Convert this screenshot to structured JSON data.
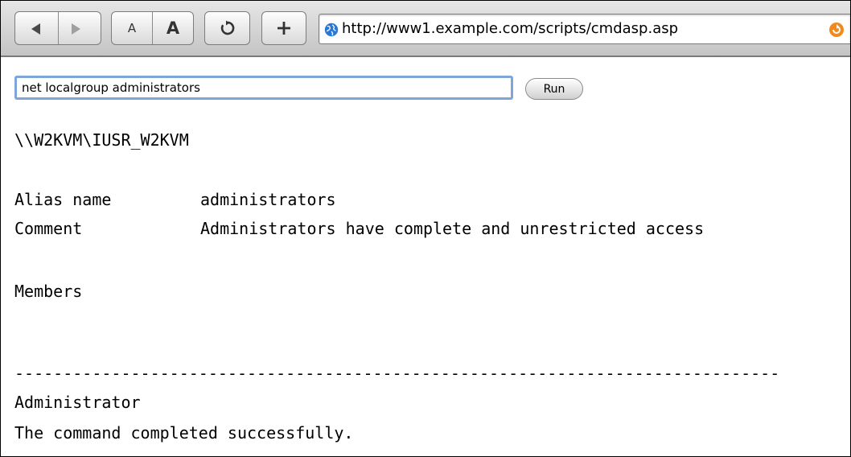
{
  "browser": {
    "url": "http://www1.example.com/scripts/cmdasp.asp",
    "font_small_label": "A",
    "font_large_label": "A",
    "icons": {
      "back": "back-arrow-icon",
      "forward": "forward-arrow-icon",
      "reload": "reload-icon",
      "add": "plus-icon",
      "site": "globe-icon",
      "snapback": "snapback-icon"
    },
    "colors": {
      "input_focus": "#7ea6d8",
      "snapback": "#f28a1b",
      "globe": "#2a78d6"
    }
  },
  "form": {
    "command_value": "net localgroup administrators",
    "run_label": "Run"
  },
  "output": {
    "user_line": "\\\\W2KVM\\IUSR_W2KVM",
    "alias_key": "Alias name",
    "alias_value": "administrators",
    "comment_key": "Comment",
    "comment_value": "Administrators have complete and unrestricted access",
    "members_heading": "Members",
    "separator": "-------------------------------------------------------------------------------",
    "member": "Administrator",
    "status": "The command completed successfully."
  }
}
